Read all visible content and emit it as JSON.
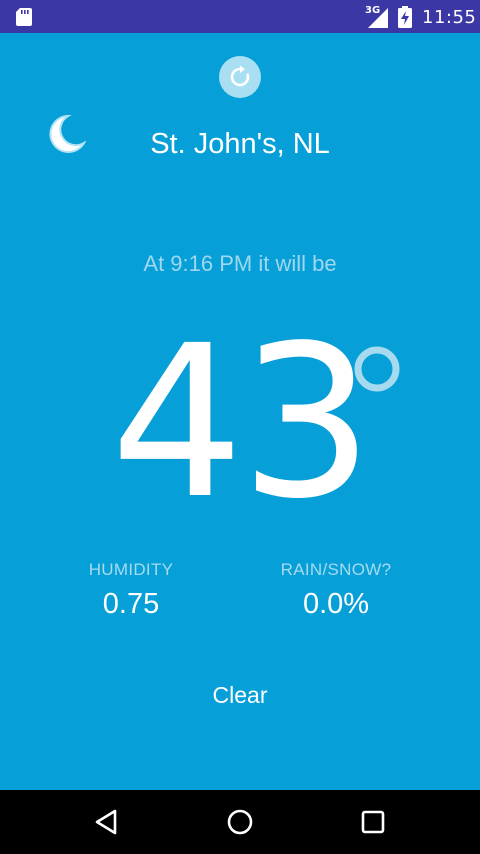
{
  "status_bar": {
    "network": "3G",
    "time": "11:55"
  },
  "weather": {
    "location": "St. John's, NL",
    "time_label": "At 9:16 PM it will be",
    "temperature": "43",
    "humidity_label": "HUMIDITY",
    "humidity_value": "0.75",
    "precip_label": "RAIN/SNOW?",
    "precip_value": "0.0%",
    "summary": "Clear",
    "condition_icon": "moon-icon"
  },
  "colors": {
    "background": "#079FD8",
    "status_bar": "#3B37A5",
    "nav_bar": "#000000",
    "muted_text": "#9ED8EE"
  },
  "icons": {
    "refresh": "refresh-icon",
    "degree": "degree-icon",
    "nav": [
      "back-icon",
      "home-icon",
      "recents-icon"
    ]
  }
}
